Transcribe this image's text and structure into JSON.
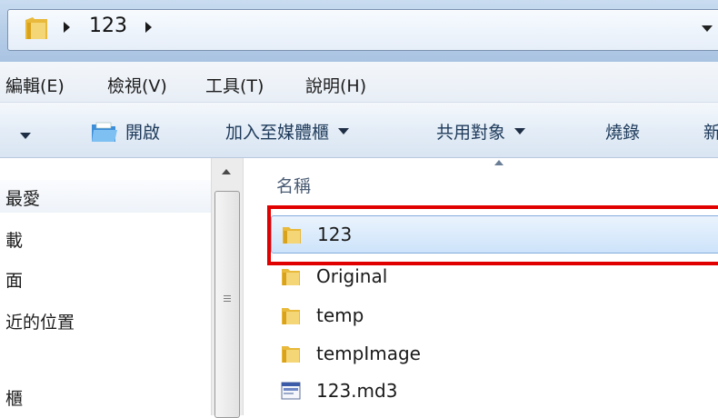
{
  "address_bar": {
    "crumb": "123"
  },
  "menu": {
    "items": [
      "編輯(E)",
      "檢視(V)",
      "工具(T)",
      "說明(H)"
    ]
  },
  "toolbar": {
    "open_label": "開啟",
    "add_to_library_label": "加入至媒體櫃",
    "share_with_label": "共用對象",
    "burn_label": "燒錄",
    "new_folder_partial": "新"
  },
  "nav": {
    "items": [
      "最愛",
      "載",
      "面",
      "近的位置",
      "櫃"
    ]
  },
  "file_list": {
    "column_name": "名稱",
    "files": [
      {
        "name": "123",
        "type": "folder",
        "selected": true
      },
      {
        "name": "Original",
        "type": "folder",
        "selected": false
      },
      {
        "name": "temp",
        "type": "folder",
        "selected": false
      },
      {
        "name": "tempImage",
        "type": "folder",
        "selected": false
      },
      {
        "name": "123.md3",
        "type": "file",
        "selected": false
      }
    ]
  },
  "colors": {
    "highlight_border": "#e00000",
    "selection_fill": "#cde3fa",
    "folder_yellow": "#f2c94c"
  }
}
